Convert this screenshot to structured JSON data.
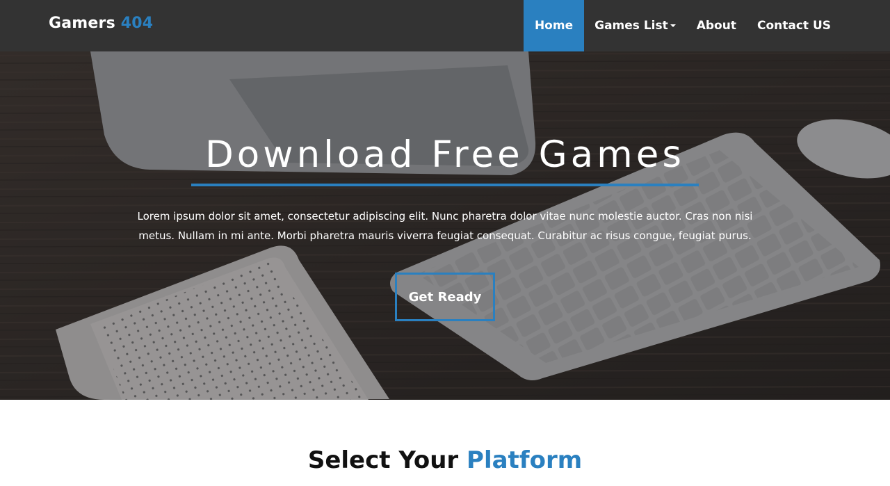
{
  "navbar": {
    "brand_name": "Gamers",
    "brand_accent": "404",
    "items": [
      {
        "label": "Home",
        "active": true
      },
      {
        "label": "Games List",
        "has_dropdown": true
      },
      {
        "label": "About"
      },
      {
        "label": "Contact US"
      }
    ]
  },
  "hero": {
    "title": "Download Free Games",
    "text": "Lorem ipsum dolor sit amet, consectetur adipiscing elit. Nunc pharetra dolor vitae nunc molestie auctor. Cras non nisi metus. Nullam in mi ante. Morbi pharetra mauris viverra feugiat consequat. Curabitur ac risus congue, feugiat purus.",
    "button_label": "Get Ready"
  },
  "platform_section": {
    "title_lead": "Select Your",
    "title_accent": "Platform"
  },
  "colors": {
    "accent": "#2a80c0",
    "navbar_bg": "#333333",
    "text_dark": "#111111"
  },
  "icons": [
    "caret-down-icon"
  ]
}
